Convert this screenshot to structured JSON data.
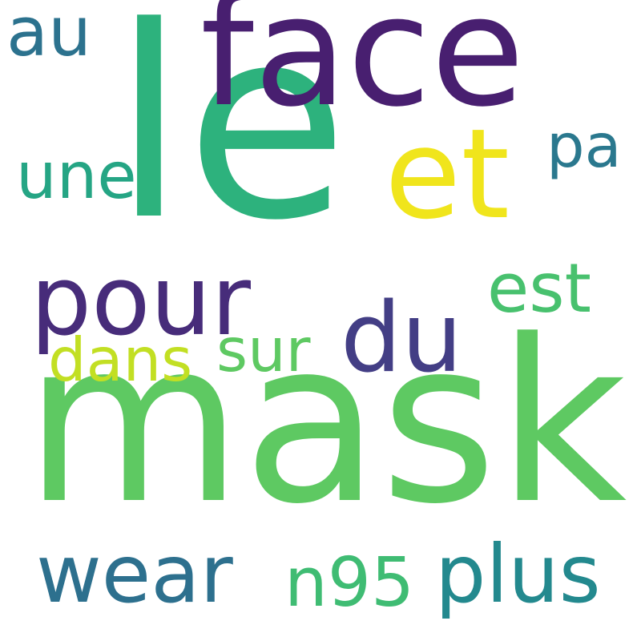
{
  "words": [
    {
      "id": "le",
      "text": "le",
      "color": "#2db27d"
    },
    {
      "id": "mask",
      "text": "mask",
      "color": "#5ec962"
    },
    {
      "id": "face",
      "text": "face",
      "color": "#481f70"
    },
    {
      "id": "et",
      "text": "et",
      "color": "#f0e51c"
    },
    {
      "id": "pour",
      "text": "pour",
      "color": "#472c7a"
    },
    {
      "id": "du",
      "text": "du",
      "color": "#433e85"
    },
    {
      "id": "est",
      "text": "est",
      "color": "#48c16e"
    },
    {
      "id": "wear",
      "text": "wear",
      "color": "#2d708e"
    },
    {
      "id": "plus",
      "text": "plus",
      "color": "#23898e"
    },
    {
      "id": "n95",
      "text": "n95",
      "color": "#3fbc73"
    },
    {
      "id": "une",
      "text": "une",
      "color": "#25a584"
    },
    {
      "id": "au",
      "text": "au",
      "color": "#2c728e"
    },
    {
      "id": "pa",
      "text": "pa",
      "color": "#2a788e"
    },
    {
      "id": "dans",
      "text": "dans",
      "color": "#c2df23"
    },
    {
      "id": "sur",
      "text": "sur",
      "color": "#5ec962"
    }
  ]
}
